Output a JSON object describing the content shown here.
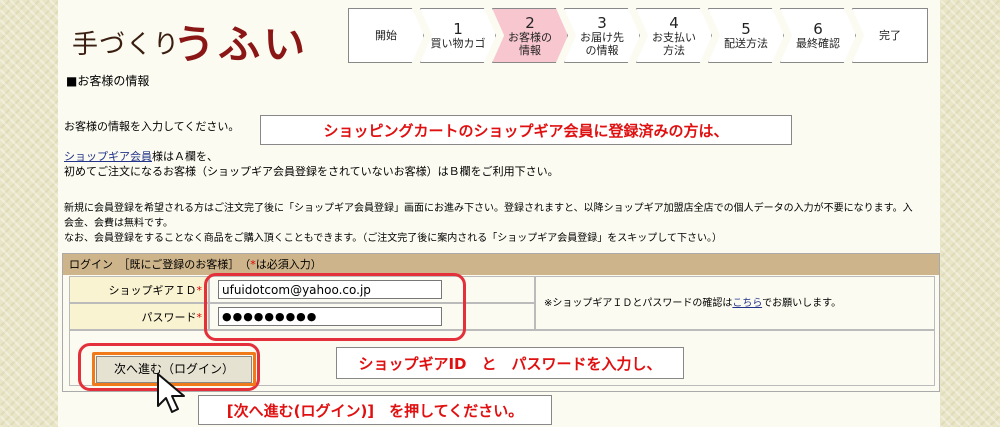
{
  "logo": {
    "prefix": "手づくり",
    "name": "うふい"
  },
  "steps": [
    {
      "num": "",
      "label": "開始"
    },
    {
      "num": "1",
      "label": "買い物カゴ"
    },
    {
      "num": "2",
      "label": "お客様の\n情報",
      "active": true
    },
    {
      "num": "3",
      "label": "お届け先\nの情報"
    },
    {
      "num": "4",
      "label": "お支払い\n方法"
    },
    {
      "num": "5",
      "label": "配送方法"
    },
    {
      "num": "6",
      "label": "最終確認"
    },
    {
      "num": "",
      "label": "完了"
    }
  ],
  "section_title": "■お客様の情報",
  "intro": "お客様の情報を入力してください。",
  "member_link": "ショップギア会員",
  "member_line_rest": "様はＡ欄を、",
  "first_time_line": "初めてご注文になるお客様（ショップギア会員登録をされていないお客様）はＢ欄をご利用下さい。",
  "info_line1": "新規に会員登録を希望される方はご注文完了後に「ショップギア会員登録」画面にお進み下さい。登録されますと、以降ショップギア加盟店全店での個人データの入力が不要になります。入",
  "info_line2": "会金、会費は無料です。",
  "info_line3": "なお、会員登録をすることなく商品をご購入頂くこともできます。（ご注文完了後に案内される「ショップギア会員登録」をスキップして下さい。）",
  "callouts": {
    "top": "ショッピングカートのショップギア会員に登録済みの方は、",
    "middle": "ショップギアID　と　パスワードを入力し、",
    "bottom": "[次へ進む(ログイン)]　を押してください。"
  },
  "form": {
    "header_prefix": "ログイン　［既にご登録のお客様］　（",
    "header_star": "*",
    "header_suffix": "は必須入力）",
    "id_label": "ショップギアＩＤ",
    "password_label": "パスワード",
    "required_mark": "*",
    "id_value": "ufuidotcom@yahoo.co.jp",
    "password_value": "●●●●●●●●●",
    "note_prefix": "※ショップギアＩＤとパスワードの確認は",
    "note_link": "こちら",
    "note_suffix": "でお願いします。",
    "next_button": "次へ進む（ログイン）"
  },
  "colors": {
    "accent_red": "#e01010",
    "step_active": "#f7c6cf",
    "form_header": "#cdb48a"
  }
}
